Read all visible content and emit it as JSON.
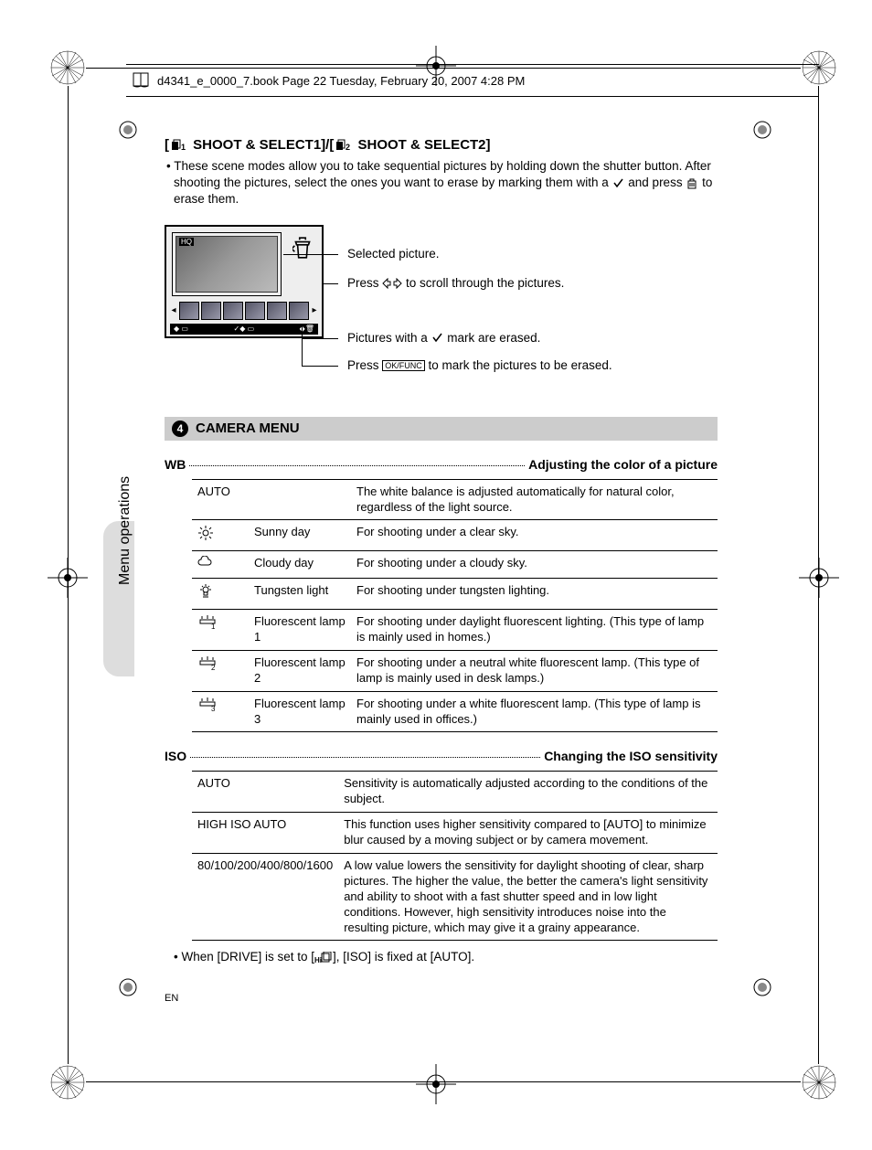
{
  "header": {
    "text": "d4341_e_0000_7.book  Page 22  Tuesday, February 20, 2007  4:28 PM"
  },
  "shoot_select": {
    "title_pre": "[",
    "title_mid1": " SHOOT & SELECT1]/[",
    "title_mid2": " SHOOT & SELECT2]",
    "desc_line1": "These scene modes allow you to take sequential pictures by holding down the shutter button. After shooting the pictures, select the ones you want to erase by marking them with a ",
    "desc_line2": " and press ",
    "desc_line3": " to erase them.",
    "callout1": "Selected picture.",
    "callout2a": "Press ",
    "callout2b": " to scroll through the pictures.",
    "callout3a": "Pictures with a ",
    "callout3b": " mark are erased.",
    "callout4a": "Press ",
    "callout4b": " to mark the pictures to be erased."
  },
  "camera_menu": {
    "num": "4",
    "title": "CAMERA MENU"
  },
  "wb": {
    "label": "WB",
    "desc": "Adjusting the color of a picture",
    "rows": [
      {
        "c1": "AUTO",
        "c2": "",
        "c3": "The white balance is adjusted automatically for natural color, regardless of the light source."
      },
      {
        "c1_icon": "sun",
        "c2": "Sunny day",
        "c3": "For shooting under a clear sky."
      },
      {
        "c1_icon": "cloud",
        "c2": "Cloudy day",
        "c3": "For shooting under a cloudy sky."
      },
      {
        "c1_icon": "tungsten",
        "c2": "Tungsten light",
        "c3": "For shooting under tungsten lighting."
      },
      {
        "c1_icon": "fluor1",
        "c2": "Fluorescent lamp 1",
        "c3": "For shooting under daylight fluorescent lighting. (This type of lamp is mainly used in homes.)"
      },
      {
        "c1_icon": "fluor2",
        "c2": "Fluorescent lamp 2",
        "c3": "For shooting under a neutral white fluorescent lamp. (This type of lamp is mainly used in desk lamps.)"
      },
      {
        "c1_icon": "fluor3",
        "c2": "Fluorescent lamp 3",
        "c3": "For shooting under a white fluorescent lamp. (This type of lamp is mainly used in offices.)"
      }
    ]
  },
  "iso": {
    "label": "ISO",
    "desc": "Changing the ISO sensitivity",
    "rows": [
      {
        "c1": "AUTO",
        "c2": "Sensitivity is automatically adjusted according to the conditions of the subject."
      },
      {
        "c1": "HIGH ISO AUTO",
        "c2": "This function uses higher sensitivity compared to [AUTO] to minimize blur caused by a moving subject or by camera movement."
      },
      {
        "c1": "80/100/200/400/800/1600",
        "c2": "A low value lowers the sensitivity for daylight shooting of clear, sharp pictures. The higher the value, the better the camera's light sensitivity and ability to shoot with a fast shutter speed and in low light conditions. However, high sensitivity introduces noise into the resulting picture, which may give it a grainy appearance."
      }
    ],
    "note_pre": "When [DRIVE] is set to [",
    "note_post": "], [ISO] is fixed at [AUTO]."
  },
  "sidetab": "Menu operations",
  "footer": "EN",
  "okfunc": "OK/FUNC"
}
